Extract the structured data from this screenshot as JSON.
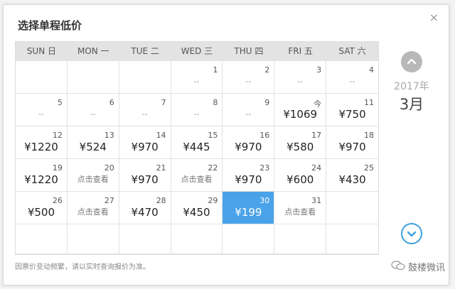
{
  "dialog": {
    "title": "选择单程低价",
    "close_label": "×"
  },
  "calendar": {
    "weekdays": [
      "SUN 日",
      "MON 一",
      "TUE 二",
      "WED 三",
      "THU 四",
      "FRI 五",
      "SAT 六"
    ],
    "cells": [
      {
        "day": "",
        "price": ""
      },
      {
        "day": "",
        "price": ""
      },
      {
        "day": "",
        "price": ""
      },
      {
        "day": "1",
        "price": "--"
      },
      {
        "day": "2",
        "price": "--"
      },
      {
        "day": "3",
        "price": "--"
      },
      {
        "day": "4",
        "price": "--"
      },
      {
        "day": "5",
        "price": "--"
      },
      {
        "day": "6",
        "price": "--"
      },
      {
        "day": "7",
        "price": "--"
      },
      {
        "day": "8",
        "price": "--"
      },
      {
        "day": "9",
        "price": "--"
      },
      {
        "day": "今",
        "price": "¥1069"
      },
      {
        "day": "11",
        "price": "¥750"
      },
      {
        "day": "12",
        "price": "¥1220"
      },
      {
        "day": "13",
        "price": "¥524"
      },
      {
        "day": "14",
        "price": "¥970"
      },
      {
        "day": "15",
        "price": "¥445"
      },
      {
        "day": "16",
        "price": "¥970"
      },
      {
        "day": "17",
        "price": "¥580"
      },
      {
        "day": "18",
        "price": "¥970"
      },
      {
        "day": "19",
        "price": "¥1220"
      },
      {
        "day": "20",
        "price": "点击查看"
      },
      {
        "day": "21",
        "price": "¥970"
      },
      {
        "day": "22",
        "price": "点击查看"
      },
      {
        "day": "23",
        "price": "¥970"
      },
      {
        "day": "24",
        "price": "¥600"
      },
      {
        "day": "25",
        "price": "¥430"
      },
      {
        "day": "26",
        "price": "¥500"
      },
      {
        "day": "27",
        "price": "点击查看"
      },
      {
        "day": "28",
        "price": "¥470"
      },
      {
        "day": "29",
        "price": "¥450"
      },
      {
        "day": "30",
        "price": "¥199",
        "selected": true
      },
      {
        "day": "31",
        "price": "点击查看"
      },
      {
        "day": "",
        "price": ""
      },
      {
        "day": "",
        "price": ""
      },
      {
        "day": "",
        "price": ""
      },
      {
        "day": "",
        "price": ""
      },
      {
        "day": "",
        "price": ""
      },
      {
        "day": "",
        "price": ""
      },
      {
        "day": "",
        "price": ""
      },
      {
        "day": "",
        "price": ""
      }
    ]
  },
  "side": {
    "year": "2017年",
    "month": "3月",
    "up_icon": "chevron-up-icon",
    "down_icon": "chevron-down-icon"
  },
  "footnote": "因票价变动频繁，请以实时查询报价为准。",
  "watermark": {
    "text": "鼓楼微讯",
    "icon": "wechat-icon"
  },
  "colors": {
    "selected": "#4aa3e8",
    "header_bg": "#e3e3e3",
    "down_arrow": "#3ea0de",
    "up_arrow": "#b8b8b8"
  }
}
